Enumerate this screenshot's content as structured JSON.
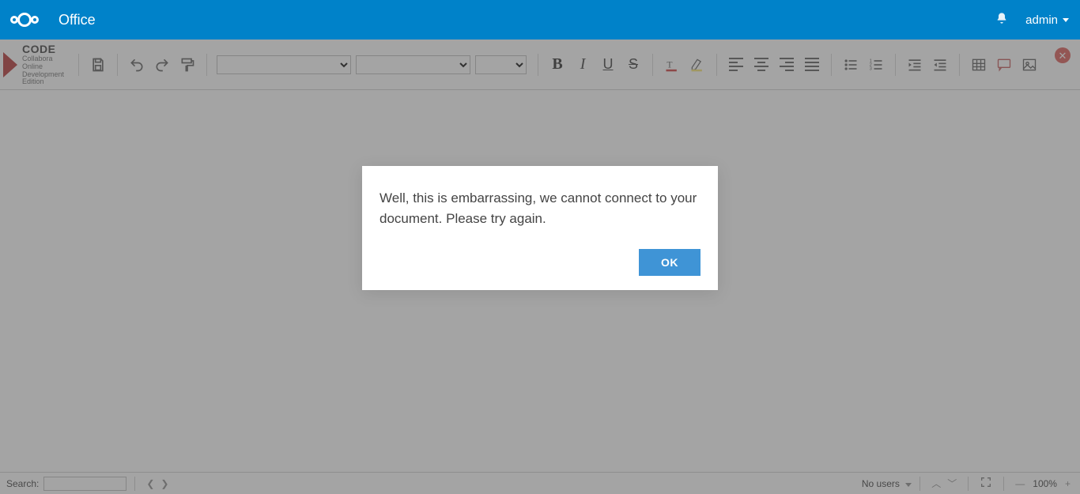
{
  "header": {
    "app_title": "Office",
    "notification_icon": "bell-icon",
    "user_name": "admin"
  },
  "brand": {
    "title": "CODE",
    "sub1": "Collabora Online",
    "sub2": "Development Edition"
  },
  "toolbar": {
    "style_value": "",
    "font_value": "",
    "size_value": "",
    "bold_label": "B",
    "italic_label": "I",
    "underline_label": "U",
    "strike_label": "S",
    "close_icon_label": "✕"
  },
  "dialog": {
    "message": "Well, this is embarrassing, we cannot connect to your document. Please try again.",
    "ok_label": "OK"
  },
  "statusbar": {
    "search_label": "Search:",
    "search_value": "",
    "users_label": "No users",
    "zoom_label": "100%",
    "prev_icon": "❮",
    "next_icon": "❯",
    "up_icon": "︿",
    "down_icon": "﹀",
    "minus": "—",
    "plus": "+"
  }
}
